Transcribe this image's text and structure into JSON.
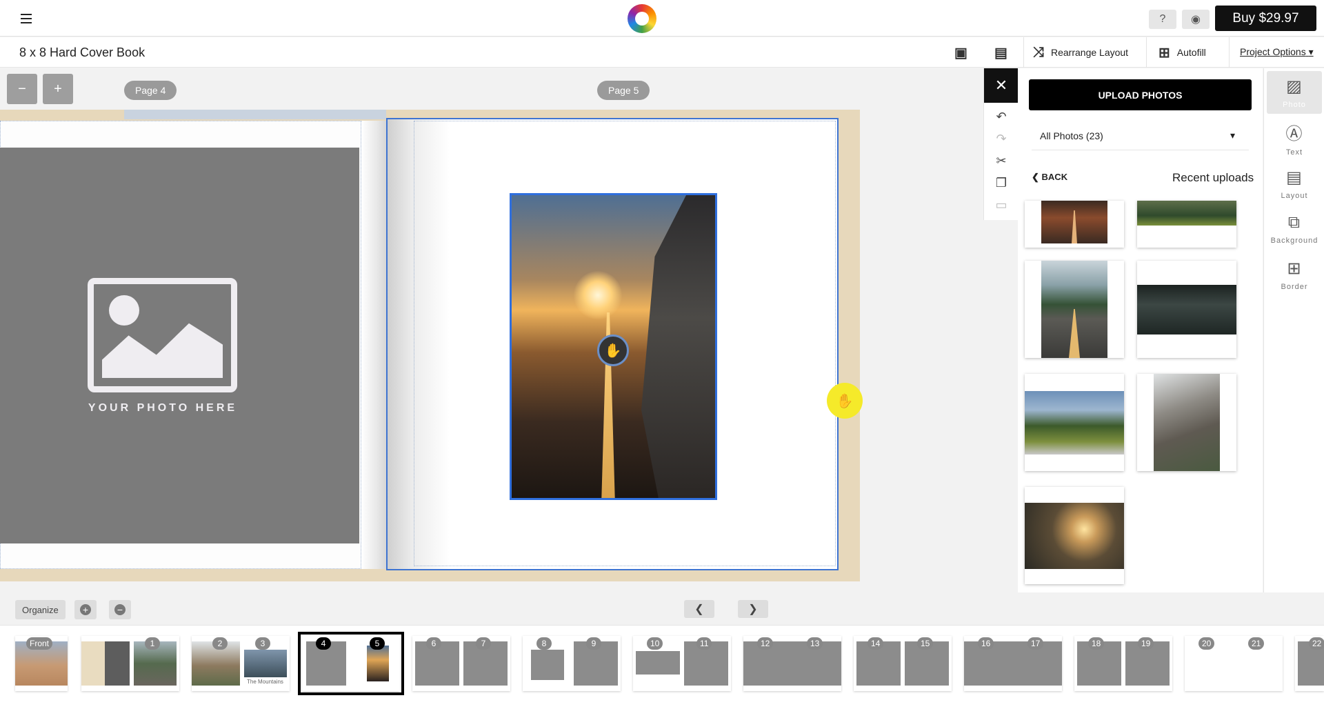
{
  "app": {
    "buy_label": "Buy $29.97",
    "project_title": "8 x 8 Hard Cover Book"
  },
  "toolbar": {
    "rearrange_label": "Rearrange Layout",
    "autofill_label": "Autofill",
    "project_options_label": "Project Options"
  },
  "canvas": {
    "page_left_label": "Page 4",
    "page_right_label": "Page 5",
    "placeholder_text": "YOUR PHOTO HERE"
  },
  "panel": {
    "upload_label": "UPLOAD PHOTOS",
    "album_selected": "All Photos (23)",
    "back_label": "BACK",
    "recent_label": "Recent uploads",
    "thumbnails": [
      "road-desert",
      "mountain-meadow",
      "road-forest",
      "valley-dark",
      "person-on-car",
      "rock-cliff",
      "sunset-lake"
    ]
  },
  "rail": {
    "tabs": [
      "Photo",
      "Text",
      "Layout",
      "Background",
      "Border"
    ]
  },
  "nav": {
    "organize_label": "Organize"
  },
  "filmstrip": {
    "front_label": "Front",
    "thumb_caption": "The Mountains",
    "page_numbers": [
      "1",
      "2",
      "3",
      "4",
      "5",
      "6",
      "7",
      "8",
      "9",
      "10",
      "11",
      "12",
      "13",
      "14",
      "15",
      "16",
      "17",
      "18",
      "19",
      "20",
      "21",
      "22"
    ]
  }
}
